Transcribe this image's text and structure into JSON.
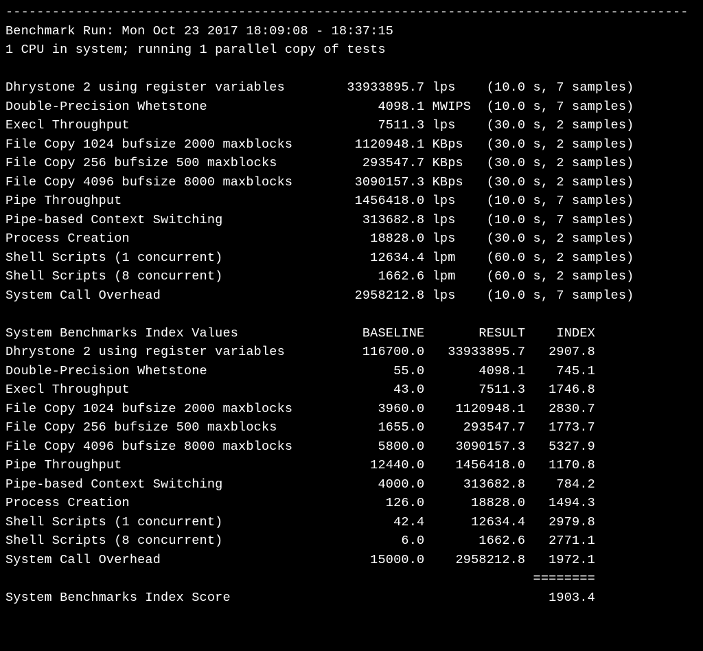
{
  "run_header": "Benchmark Run: Mon Oct 23 2017 18:09:08 - 18:37:15",
  "cpu_header": "1 CPU in system; running 1 parallel copy of tests",
  "results": [
    {
      "name": "Dhrystone 2 using register variables",
      "value": "33933895.7",
      "unit": "lps",
      "dur": "10.0",
      "samples": "7"
    },
    {
      "name": "Double-Precision Whetstone",
      "value": "4098.1",
      "unit": "MWIPS",
      "dur": "10.0",
      "samples": "7"
    },
    {
      "name": "Execl Throughput",
      "value": "7511.3",
      "unit": "lps",
      "dur": "30.0",
      "samples": "2"
    },
    {
      "name": "File Copy 1024 bufsize 2000 maxblocks",
      "value": "1120948.1",
      "unit": "KBps",
      "dur": "30.0",
      "samples": "2"
    },
    {
      "name": "File Copy 256 bufsize 500 maxblocks",
      "value": "293547.7",
      "unit": "KBps",
      "dur": "30.0",
      "samples": "2"
    },
    {
      "name": "File Copy 4096 bufsize 8000 maxblocks",
      "value": "3090157.3",
      "unit": "KBps",
      "dur": "30.0",
      "samples": "2"
    },
    {
      "name": "Pipe Throughput",
      "value": "1456418.0",
      "unit": "lps",
      "dur": "10.0",
      "samples": "7"
    },
    {
      "name": "Pipe-based Context Switching",
      "value": "313682.8",
      "unit": "lps",
      "dur": "10.0",
      "samples": "7"
    },
    {
      "name": "Process Creation",
      "value": "18828.0",
      "unit": "lps",
      "dur": "30.0",
      "samples": "2"
    },
    {
      "name": "Shell Scripts (1 concurrent)",
      "value": "12634.4",
      "unit": "lpm",
      "dur": "60.0",
      "samples": "2"
    },
    {
      "name": "Shell Scripts (8 concurrent)",
      "value": "1662.6",
      "unit": "lpm",
      "dur": "60.0",
      "samples": "2"
    },
    {
      "name": "System Call Overhead",
      "value": "2958212.8",
      "unit": "lps",
      "dur": "10.0",
      "samples": "7"
    }
  ],
  "index_header": {
    "title": "System Benchmarks Index Values",
    "c1": "BASELINE",
    "c2": "RESULT",
    "c3": "INDEX"
  },
  "index_rows": [
    {
      "name": "Dhrystone 2 using register variables",
      "baseline": "116700.0",
      "result": "33933895.7",
      "index": "2907.8"
    },
    {
      "name": "Double-Precision Whetstone",
      "baseline": "55.0",
      "result": "4098.1",
      "index": "745.1"
    },
    {
      "name": "Execl Throughput",
      "baseline": "43.0",
      "result": "7511.3",
      "index": "1746.8"
    },
    {
      "name": "File Copy 1024 bufsize 2000 maxblocks",
      "baseline": "3960.0",
      "result": "1120948.1",
      "index": "2830.7"
    },
    {
      "name": "File Copy 256 bufsize 500 maxblocks",
      "baseline": "1655.0",
      "result": "293547.7",
      "index": "1773.7"
    },
    {
      "name": "File Copy 4096 bufsize 8000 maxblocks",
      "baseline": "5800.0",
      "result": "3090157.3",
      "index": "5327.9"
    },
    {
      "name": "Pipe Throughput",
      "baseline": "12440.0",
      "result": "1456418.0",
      "index": "1170.8"
    },
    {
      "name": "Pipe-based Context Switching",
      "baseline": "4000.0",
      "result": "313682.8",
      "index": "784.2"
    },
    {
      "name": "Process Creation",
      "baseline": "126.0",
      "result": "18828.0",
      "index": "1494.3"
    },
    {
      "name": "Shell Scripts (1 concurrent)",
      "baseline": "42.4",
      "result": "12634.4",
      "index": "2979.8"
    },
    {
      "name": "Shell Scripts (8 concurrent)",
      "baseline": "6.0",
      "result": "1662.6",
      "index": "2771.1"
    },
    {
      "name": "System Call Overhead",
      "baseline": "15000.0",
      "result": "2958212.8",
      "index": "1972.1"
    }
  ],
  "score_label": "System Benchmarks Index Score",
  "score_value": "1903.4"
}
